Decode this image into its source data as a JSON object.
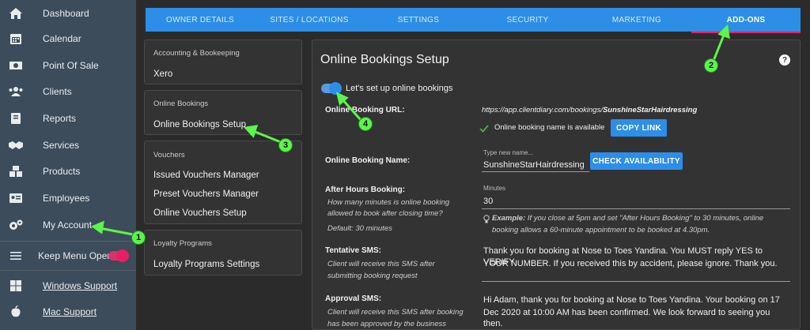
{
  "sidebar": {
    "items": [
      {
        "label": "Dashboard",
        "icon": "home-icon"
      },
      {
        "label": "Calendar",
        "icon": "calendar-icon"
      },
      {
        "label": "Point Of Sale",
        "icon": "cash-icon"
      },
      {
        "label": "Clients",
        "icon": "users-icon"
      },
      {
        "label": "Reports",
        "icon": "book-icon"
      },
      {
        "label": "Services",
        "icon": "handshake-icon"
      },
      {
        "label": "Products",
        "icon": "cubes-icon"
      },
      {
        "label": "Employees",
        "icon": "id-card-icon"
      },
      {
        "label": "My Account",
        "icon": "gears-icon"
      }
    ],
    "keep_menu_open": "Keep Menu Open",
    "windows_support": "Windows Support",
    "mac_support": "Mac Support"
  },
  "tabs": [
    "OWNER DETAILS",
    "SITES / LOCATIONS",
    "SETTINGS",
    "SECURITY",
    "MARKETING",
    "ADD-ONS"
  ],
  "active_tab": "ADD-ONS",
  "left_cards": {
    "accounting": {
      "heading": "Accounting & Bookeeping",
      "items": [
        "Xero"
      ]
    },
    "online_bookings": {
      "heading": "Online Bookings",
      "items": [
        "Online Bookings Setup"
      ]
    },
    "vouchers": {
      "heading": "Vouchers",
      "items": [
        "Issued Vouchers Manager",
        "Preset Vouchers Manager",
        "Online Vouchers Setup"
      ]
    },
    "loyalty": {
      "heading": "Loyalty Programs",
      "items": [
        "Loyalty Programs Settings"
      ]
    }
  },
  "panel": {
    "title": "Online Bookings Setup",
    "help": "?",
    "toggle_label": "Let's set up online bookings",
    "url_label": "Online Booking URL:",
    "url_prefix": "https://app.clientdiary.com/bookings/",
    "url_name": "SunshineStarHairdressing",
    "available_text": "Online booking name is available",
    "copy_link": "COPY LINK",
    "name_label": "Online Booking Name:",
    "name_placeholder": "Type new name...",
    "name_value": "SunshineStarHairdressing",
    "check_availability": "CHECK AVAILABILITY",
    "after_hours_label": "After Hours Booking:",
    "after_hours_sub1": "How many minutes is online booking",
    "after_hours_sub2": "allowed to book after closing time?",
    "after_hours_default": "Default: 30 minutes",
    "minutes_label": "Minutes",
    "minutes_value": "30",
    "example_bold": "Example:",
    "example_line1": "If you close at 5pm and set \"After Hours Booking\" to 30 minutes, online",
    "example_line2": "booking allows a 60-minute appointment to be booked at 4.30pm.",
    "tentative_label": "Tentative SMS:",
    "tentative_sub1": "Client will receive this SMS after",
    "tentative_sub2": "submitting booking request",
    "tentative_msg1": "Thank you for booking at Nose to Toes Yandina. You MUST reply YES to VERIFY",
    "tentative_msg2": "YOUR NUMBER. If you received this by accident, please ignore. Thank you.",
    "approval_label": "Approval SMS:",
    "approval_sub1": "Client will receive this SMS after booking",
    "approval_sub2": "has been approved by the business",
    "approval_msg1": "Hi Adam, thank you for booking at Nose to Toes Yandina. Your booking on 17",
    "approval_msg2": "Dec 2020 at 10:00 AM has been confirmed. We look forward to seeing you then."
  },
  "annotations": [
    "1",
    "2",
    "3",
    "4"
  ],
  "colors": {
    "accent": "#2d8ee8",
    "pink": "#e91e63",
    "annotation": "#5cf54c"
  }
}
